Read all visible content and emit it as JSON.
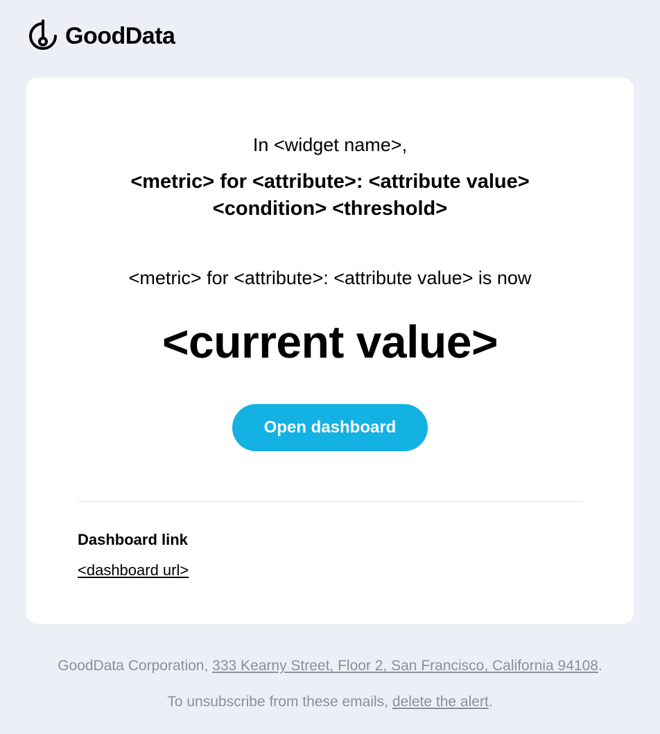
{
  "brand": "GoodData",
  "alert": {
    "intro": "In <widget name>,",
    "headline": "<metric> for <attribute>: <attribute value> <condition> <threshold>",
    "status_line": "<metric> for <attribute>: <attribute value> is now",
    "current_value": "<current value>",
    "cta_label": "Open dashboard"
  },
  "dashboard_link": {
    "heading": "Dashboard link",
    "url_text": "<dashboard url>"
  },
  "footer": {
    "company": "GoodData Corporation, ",
    "address": "333 Kearny Street, Floor 2, San Francisco, California 94108",
    "period": ".",
    "unsubscribe_prefix": "To unsubscribe from these emails, ",
    "unsubscribe_link": "delete the alert",
    "unsubscribe_suffix": "."
  }
}
